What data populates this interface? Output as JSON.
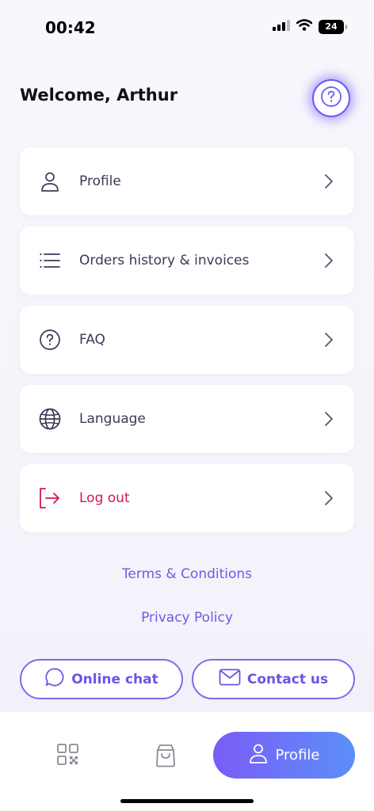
{
  "status_bar": {
    "time": "00:42",
    "battery": "24"
  },
  "header": {
    "welcome": "Welcome, Arthur",
    "help_icon": "help-circle-icon"
  },
  "menu": [
    {
      "label": "Profile",
      "icon": "user-icon"
    },
    {
      "label": "Orders history & invoices",
      "icon": "list-icon"
    },
    {
      "label": "FAQ",
      "icon": "help-circle-icon"
    },
    {
      "label": "Language",
      "icon": "globe-icon"
    },
    {
      "label": "Log out",
      "icon": "logout-icon"
    }
  ],
  "links": {
    "terms": "Terms & Conditions",
    "privacy": "Privacy Policy"
  },
  "actions": {
    "chat": "Online chat",
    "contact": "Contact us"
  },
  "tabbar": {
    "active_label": "Profile"
  },
  "colors": {
    "accent": "#6c5ce7",
    "danger": "#d4145a",
    "text": "#3a3a57"
  }
}
